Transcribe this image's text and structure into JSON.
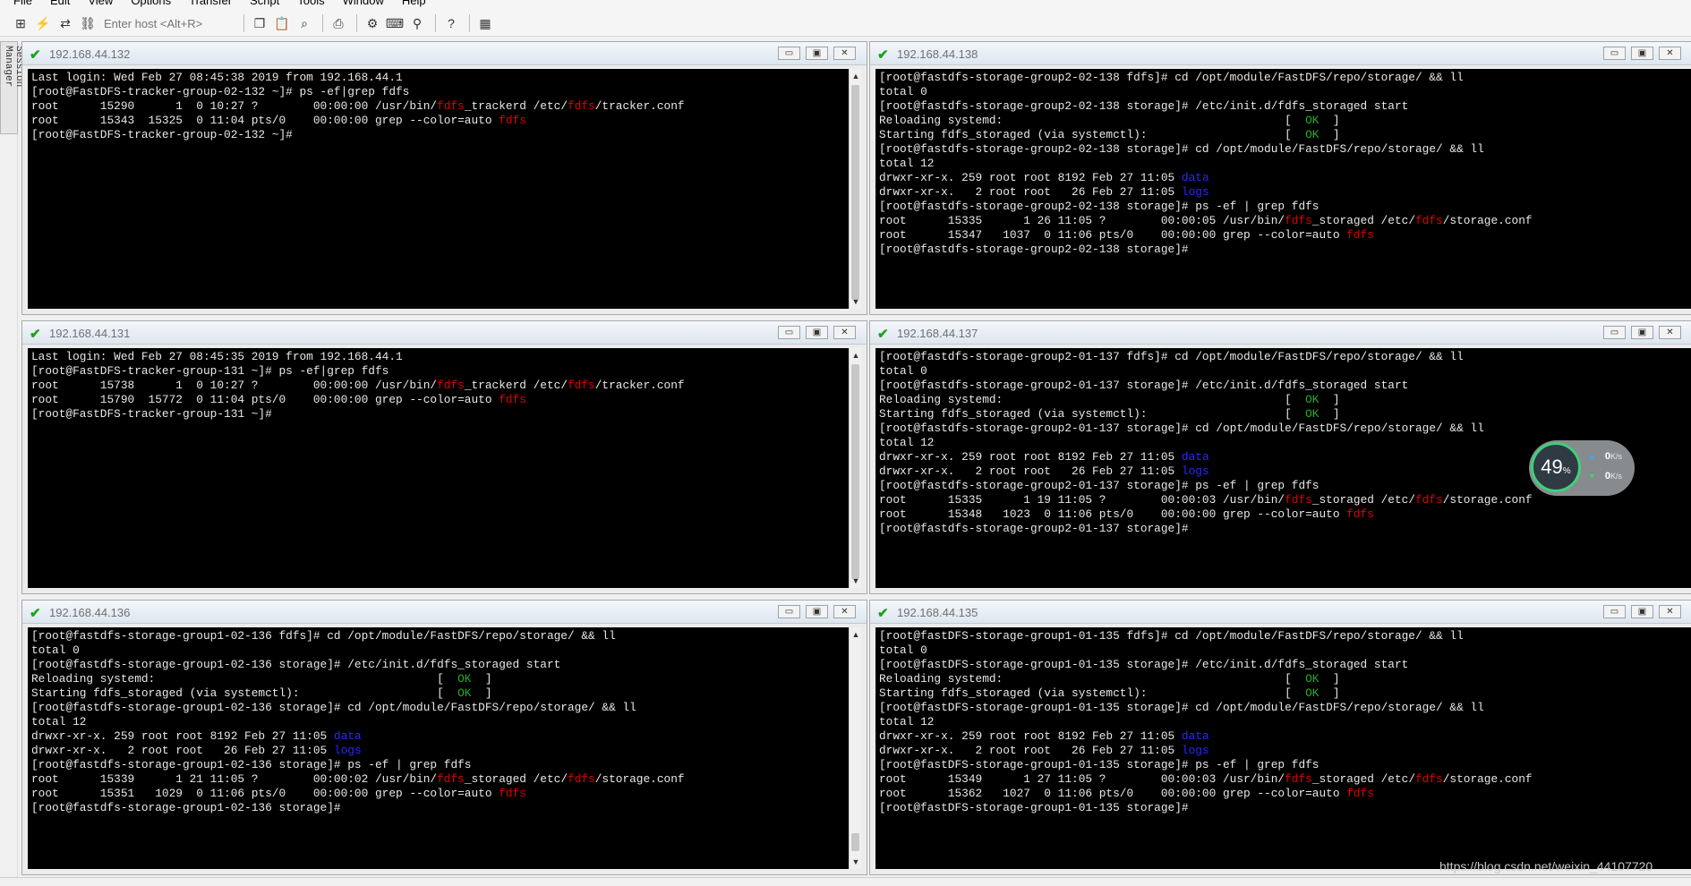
{
  "menubar": [
    "File",
    "Edit",
    "View",
    "Options",
    "Transfer",
    "Script",
    "Tools",
    "Window",
    "Help"
  ],
  "toolbar": {
    "host_placeholder": "Enter host <Alt+R>",
    "icons": [
      "connect-in-tab-icon",
      "quick-connect-icon",
      "reconnect-icon",
      "disconnect-icon",
      "copy-icon",
      "paste-icon",
      "find-icon",
      "print-icon",
      "settings-icon",
      "keymap-icon",
      "sftp-icon",
      "help-icon",
      "tile-icon"
    ]
  },
  "session_manager": {
    "label": "Session Manager"
  },
  "panes": [
    {
      "title": "192.168.44.132",
      "lines": [
        [
          [
            "Last login: Wed Feb 27 08:45:38 2019 from 192.168.44.1",
            ""
          ]
        ],
        [
          [
            "[root@FastDFS-tracker-group-02-132 ~]# ps -ef|grep fdfs",
            ""
          ]
        ],
        [
          [
            "root      15290      1  0 10:27 ?        00:00:00 /usr/bin/",
            ""
          ],
          [
            "fdfs",
            "r"
          ],
          [
            "_trackerd /etc/",
            ""
          ],
          [
            "fdfs",
            "r"
          ],
          [
            "/tracker.conf",
            ""
          ]
        ],
        [
          [
            "root      15343  15325  0 11:04 pts/0    00:00:00 grep --color=auto ",
            ""
          ],
          [
            "fdfs",
            "r"
          ]
        ],
        [
          [
            "[root@FastDFS-tracker-group-02-132 ~]#",
            ""
          ]
        ]
      ]
    },
    {
      "title": "192.168.44.138",
      "lines": [
        [
          [
            "[root@fastdfs-storage-group2-02-138 fdfs]# cd /opt/module/FastDFS/repo/storage/ && ll",
            ""
          ]
        ],
        [
          [
            "total 0",
            ""
          ]
        ],
        [
          [
            "[root@fastdfs-storage-group2-02-138 storage]# /etc/init.d/fdfs_storaged start",
            ""
          ]
        ],
        [
          [
            "Reloading systemd:                                         [  ",
            ""
          ],
          [
            "OK",
            "g"
          ],
          [
            "  ]",
            ""
          ]
        ],
        [
          [
            "Starting fdfs_storaged (via systemctl):                    [  ",
            ""
          ],
          [
            "OK",
            "g"
          ],
          [
            "  ]",
            ""
          ]
        ],
        [
          [
            "[root@fastdfs-storage-group2-02-138 storage]# cd /opt/module/FastDFS/repo/storage/ && ll",
            ""
          ]
        ],
        [
          [
            "total 12",
            ""
          ]
        ],
        [
          [
            "drwxr-xr-x. 259 root root 8192 Feb 27 11:05 ",
            ""
          ],
          [
            "data",
            "b"
          ]
        ],
        [
          [
            "drwxr-xr-x.   2 root root   26 Feb 27 11:05 ",
            ""
          ],
          [
            "logs",
            "b"
          ]
        ],
        [
          [
            "[root@fastdfs-storage-group2-02-138 storage]# ps -ef | grep fdfs",
            ""
          ]
        ],
        [
          [
            "root      15335      1 26 11:05 ?        00:00:05 /usr/bin/",
            ""
          ],
          [
            "fdfs",
            "r"
          ],
          [
            "_storaged /etc/",
            ""
          ],
          [
            "fdfs",
            "r"
          ],
          [
            "/storage.conf",
            ""
          ]
        ],
        [
          [
            "root      15347   1037  0 11:06 pts/0    00:00:00 grep --color=auto ",
            ""
          ],
          [
            "fdfs",
            "r"
          ]
        ],
        [
          [
            "[root@fastdfs-storage-group2-02-138 storage]#",
            ""
          ]
        ]
      ]
    },
    {
      "title": "192.168.44.131",
      "lines": [
        [
          [
            "Last login: Wed Feb 27 08:45:35 2019 from 192.168.44.1",
            ""
          ]
        ],
        [
          [
            "[root@FastDFS-tracker-group-131 ~]# ps -ef|grep fdfs",
            ""
          ]
        ],
        [
          [
            "root      15738      1  0 10:27 ?        00:00:00 /usr/bin/",
            ""
          ],
          [
            "fdfs",
            "r"
          ],
          [
            "_trackerd /etc/",
            ""
          ],
          [
            "fdfs",
            "r"
          ],
          [
            "/tracker.conf",
            ""
          ]
        ],
        [
          [
            "root      15790  15772  0 11:04 pts/0    00:00:00 grep --color=auto ",
            ""
          ],
          [
            "fdfs",
            "r"
          ]
        ],
        [
          [
            "[root@FastDFS-tracker-group-131 ~]#",
            ""
          ]
        ]
      ]
    },
    {
      "title": "192.168.44.137",
      "lines": [
        [
          [
            "[root@fastdfs-storage-group2-01-137 fdfs]# cd /opt/module/FastDFS/repo/storage/ && ll",
            ""
          ]
        ],
        [
          [
            "total 0",
            ""
          ]
        ],
        [
          [
            "[root@fastdfs-storage-group2-01-137 storage]# /etc/init.d/fdfs_storaged start",
            ""
          ]
        ],
        [
          [
            "Reloading systemd:                                         [  ",
            ""
          ],
          [
            "OK",
            "g"
          ],
          [
            "  ]",
            ""
          ]
        ],
        [
          [
            "Starting fdfs_storaged (via systemctl):                    [  ",
            ""
          ],
          [
            "OK",
            "g"
          ],
          [
            "  ]",
            ""
          ]
        ],
        [
          [
            "[root@fastdfs-storage-group2-01-137 storage]# cd /opt/module/FastDFS/repo/storage/ && ll",
            ""
          ]
        ],
        [
          [
            "total 12",
            ""
          ]
        ],
        [
          [
            "drwxr-xr-x. 259 root root 8192 Feb 27 11:05 ",
            ""
          ],
          [
            "data",
            "b"
          ]
        ],
        [
          [
            "drwxr-xr-x.   2 root root   26 Feb 27 11:05 ",
            ""
          ],
          [
            "logs",
            "b"
          ]
        ],
        [
          [
            "[root@fastdfs-storage-group2-01-137 storage]# ps -ef | grep fdfs",
            ""
          ]
        ],
        [
          [
            "root      15335      1 19 11:05 ?        00:00:03 /usr/bin/",
            ""
          ],
          [
            "fdfs",
            "r"
          ],
          [
            "_storaged /etc/",
            ""
          ],
          [
            "fdfs",
            "r"
          ],
          [
            "/storage.conf",
            ""
          ]
        ],
        [
          [
            "root      15348   1023  0 11:06 pts/0    00:00:00 grep --color=auto ",
            ""
          ],
          [
            "fdfs",
            "r"
          ]
        ],
        [
          [
            "[root@fastdfs-storage-group2-01-137 storage]#",
            ""
          ]
        ]
      ]
    },
    {
      "title": "192.168.44.136",
      "lines": [
        [
          [
            "[root@fastdfs-storage-group1-02-136 fdfs]# cd /opt/module/FastDFS/repo/storage/ && ll",
            ""
          ]
        ],
        [
          [
            "total 0",
            ""
          ]
        ],
        [
          [
            "[root@fastdfs-storage-group1-02-136 storage]# /etc/init.d/fdfs_storaged start",
            ""
          ]
        ],
        [
          [
            "Reloading systemd:                                         [  ",
            ""
          ],
          [
            "OK",
            "g"
          ],
          [
            "  ]",
            ""
          ]
        ],
        [
          [
            "Starting fdfs_storaged (via systemctl):                    [  ",
            ""
          ],
          [
            "OK",
            "g"
          ],
          [
            "  ]",
            ""
          ]
        ],
        [
          [
            "[root@fastdfs-storage-group1-02-136 storage]# cd /opt/module/FastDFS/repo/storage/ && ll",
            ""
          ]
        ],
        [
          [
            "total 12",
            ""
          ]
        ],
        [
          [
            "drwxr-xr-x. 259 root root 8192 Feb 27 11:05 ",
            ""
          ],
          [
            "data",
            "b"
          ]
        ],
        [
          [
            "drwxr-xr-x.   2 root root   26 Feb 27 11:05 ",
            ""
          ],
          [
            "logs",
            "b"
          ]
        ],
        [
          [
            "[root@fastdfs-storage-group1-02-136 storage]# ps -ef | grep fdfs",
            ""
          ]
        ],
        [
          [
            "root      15339      1 21 11:05 ?        00:00:02 /usr/bin/",
            ""
          ],
          [
            "fdfs",
            "r"
          ],
          [
            "_storaged /etc/",
            ""
          ],
          [
            "fdfs",
            "r"
          ],
          [
            "/storage.conf",
            ""
          ]
        ],
        [
          [
            "root      15351   1029  0 11:06 pts/0    00:00:00 grep --color=auto ",
            ""
          ],
          [
            "fdfs",
            "r"
          ]
        ],
        [
          [
            "[root@fastdfs-storage-group1-02-136 storage]#",
            ""
          ]
        ]
      ]
    },
    {
      "title": "192.168.44.135",
      "lines": [
        [
          [
            "[root@fastDFS-storage-group1-01-135 fdfs]# cd /opt/module/FastDFS/repo/storage/ && ll",
            ""
          ]
        ],
        [
          [
            "total 0",
            ""
          ]
        ],
        [
          [
            "[root@fastDFS-storage-group1-01-135 storage]# /etc/init.d/fdfs_storaged start",
            ""
          ]
        ],
        [
          [
            "Reloading systemd:                                         [  ",
            ""
          ],
          [
            "OK",
            "g"
          ],
          [
            "  ]",
            ""
          ]
        ],
        [
          [
            "Starting fdfs_storaged (via systemctl):                    [  ",
            ""
          ],
          [
            "OK",
            "g"
          ],
          [
            "  ]",
            ""
          ]
        ],
        [
          [
            "[root@fastDFS-storage-group1-01-135 storage]# cd /opt/module/FastDFS/repo/storage/ && ll",
            ""
          ]
        ],
        [
          [
            "total 12",
            ""
          ]
        ],
        [
          [
            "drwxr-xr-x. 259 root root 8192 Feb 27 11:05 ",
            ""
          ],
          [
            "data",
            "b"
          ]
        ],
        [
          [
            "drwxr-xr-x.   2 root root   26 Feb 27 11:05 ",
            ""
          ],
          [
            "logs",
            "b"
          ]
        ],
        [
          [
            "[root@fastDFS-storage-group1-01-135 storage]# ps -ef | grep fdfs",
            ""
          ]
        ],
        [
          [
            "root      15349      1 27 11:05 ?        00:00:03 /usr/bin/",
            ""
          ],
          [
            "fdfs",
            "r"
          ],
          [
            "_storaged /etc/",
            ""
          ],
          [
            "fdfs",
            "r"
          ],
          [
            "/storage.conf",
            ""
          ]
        ],
        [
          [
            "root      15362   1027  0 11:06 pts/0    00:00:00 grep --color=auto ",
            ""
          ],
          [
            "fdfs",
            "r"
          ]
        ],
        [
          [
            "[root@fastDFS-storage-group1-01-135 storage]#",
            ""
          ]
        ]
      ]
    }
  ],
  "speed_widget": {
    "percent": "49",
    "percent_unit": "%",
    "upload": "0",
    "download": "0",
    "unit": "K/s"
  },
  "watermark": "https://blog.csdn.net/weixin_44107720"
}
